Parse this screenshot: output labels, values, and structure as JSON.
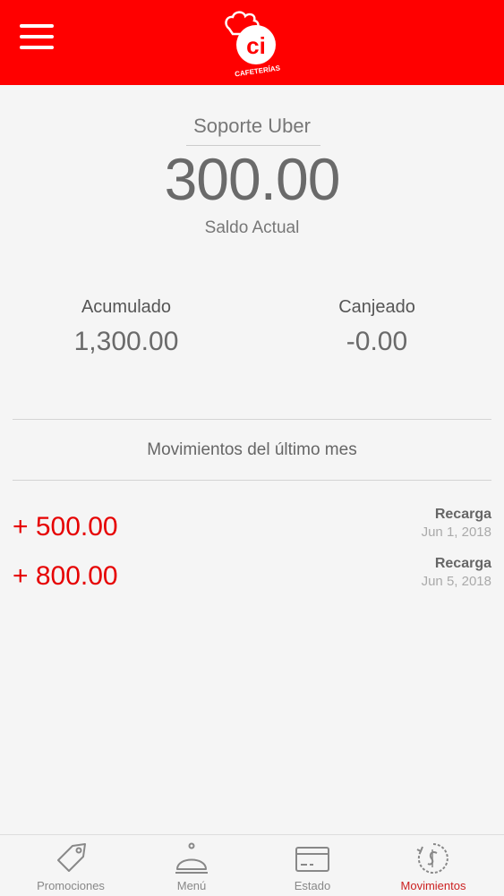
{
  "header": {
    "logo_text": "ci",
    "logo_subtext": "CAFETERÍAS"
  },
  "account": {
    "name": "Soporte Uber",
    "balance": "300.00",
    "balance_label": "Saldo Actual"
  },
  "stats": {
    "accumulated_label": "Acumulado",
    "accumulated_value": "1,300.00",
    "redeemed_label": "Canjeado",
    "redeemed_value": "-0.00"
  },
  "movements": {
    "title": "Movimientos del último mes",
    "items": [
      {
        "amount": "+ 500.00",
        "type": "Recarga",
        "date": "Jun 1, 2018"
      },
      {
        "amount": "+ 800.00",
        "type": "Recarga",
        "date": "Jun 5, 2018"
      }
    ]
  },
  "tabs": [
    {
      "label": "Promociones",
      "icon": "tag-icon"
    },
    {
      "label": "Menú",
      "icon": "cloche-icon"
    },
    {
      "label": "Estado",
      "icon": "card-icon"
    },
    {
      "label": "Movimientos",
      "icon": "history-icon",
      "active": true
    }
  ],
  "colors": {
    "brand_red": "#ff0000",
    "amount_red": "#e60000",
    "active_tab": "#cc2222"
  }
}
